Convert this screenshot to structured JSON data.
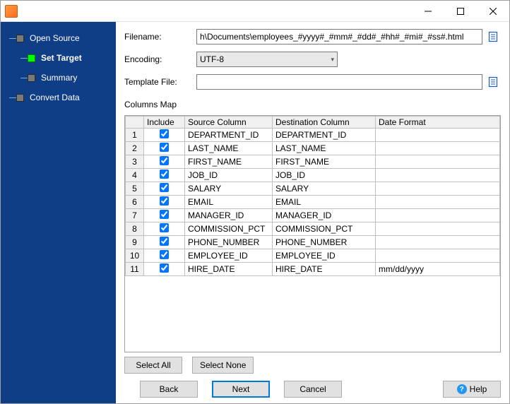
{
  "sidebar": {
    "items": [
      {
        "label": "Open Source",
        "active": false,
        "indent": false
      },
      {
        "label": "Set Target",
        "active": true,
        "indent": true
      },
      {
        "label": "Summary",
        "active": false,
        "indent": true
      },
      {
        "label": "Convert Data",
        "active": false,
        "indent": false
      }
    ]
  },
  "form": {
    "filename_label": "Filename:",
    "filename_value": "h\\Documents\\employees_#yyyy#_#mm#_#dd#_#hh#_#mi#_#ss#.html",
    "encoding_label": "Encoding:",
    "encoding_value": "UTF-8",
    "template_label": "Template File:",
    "template_value": ""
  },
  "columns_map": {
    "title": "Columns Map",
    "headers": {
      "include": "Include",
      "source": "Source Column",
      "dest": "Destination Column",
      "dateformat": "Date Format"
    },
    "rows": [
      {
        "n": "1",
        "inc": true,
        "src": "DEPARTMENT_ID",
        "dst": "DEPARTMENT_ID",
        "fmt": ""
      },
      {
        "n": "2",
        "inc": true,
        "src": "LAST_NAME",
        "dst": "LAST_NAME",
        "fmt": ""
      },
      {
        "n": "3",
        "inc": true,
        "src": "FIRST_NAME",
        "dst": "FIRST_NAME",
        "fmt": ""
      },
      {
        "n": "4",
        "inc": true,
        "src": "JOB_ID",
        "dst": "JOB_ID",
        "fmt": ""
      },
      {
        "n": "5",
        "inc": true,
        "src": "SALARY",
        "dst": "SALARY",
        "fmt": ""
      },
      {
        "n": "6",
        "inc": true,
        "src": "EMAIL",
        "dst": "EMAIL",
        "fmt": ""
      },
      {
        "n": "7",
        "inc": true,
        "src": "MANAGER_ID",
        "dst": "MANAGER_ID",
        "fmt": ""
      },
      {
        "n": "8",
        "inc": true,
        "src": "COMMISSION_PCT",
        "dst": "COMMISSION_PCT",
        "fmt": ""
      },
      {
        "n": "9",
        "inc": true,
        "src": "PHONE_NUMBER",
        "dst": "PHONE_NUMBER",
        "fmt": ""
      },
      {
        "n": "10",
        "inc": true,
        "src": "EMPLOYEE_ID",
        "dst": "EMPLOYEE_ID",
        "fmt": ""
      },
      {
        "n": "11",
        "inc": true,
        "src": "HIRE_DATE",
        "dst": "HIRE_DATE",
        "fmt": "mm/dd/yyyy"
      }
    ]
  },
  "buttons": {
    "select_all": "Select All",
    "select_none": "Select None",
    "back": "Back",
    "next": "Next",
    "cancel": "Cancel",
    "help": "Help"
  }
}
